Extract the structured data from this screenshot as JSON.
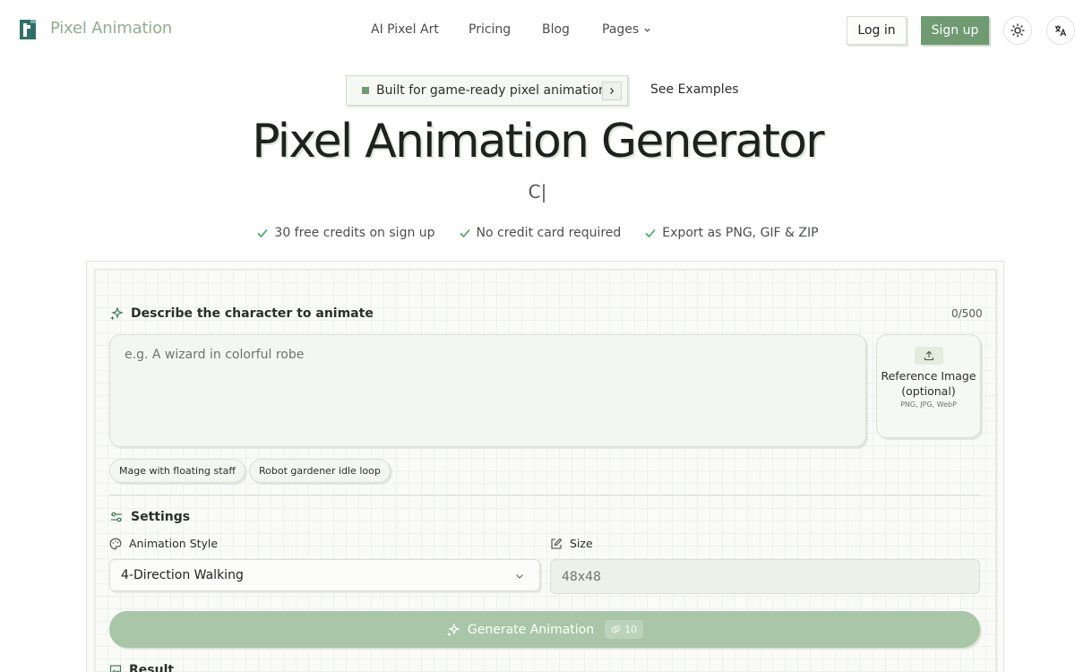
{
  "header": {
    "brand": "Pixel Animation",
    "nav": [
      {
        "label": "AI Pixel Art"
      },
      {
        "label": "Pricing"
      },
      {
        "label": "Blog"
      },
      {
        "label": "Pages"
      }
    ],
    "login_label": "Log in",
    "signup_label": "Sign up"
  },
  "hero": {
    "announcement": "Built for game-ready pixel animation",
    "see_examples": "See Examples",
    "title": "Pixel Animation Generator",
    "typing_text": "C|",
    "features": [
      {
        "label": "30 free credits on sign up"
      },
      {
        "label": "No credit card required"
      },
      {
        "label": "Export as PNG, GIF & ZIP"
      }
    ]
  },
  "generator": {
    "describe_title": "Describe the character to animate",
    "char_count": "0/500",
    "prompt_placeholder": "e.g. A wizard in colorful robe",
    "prompt_value": "",
    "reference_label": "Reference Image (optional)",
    "reference_formats": "PNG, JPG, WebP",
    "suggestions": [
      {
        "label": "Mage with floating staff"
      },
      {
        "label": "Robot gardener idle loop"
      }
    ],
    "settings_title": "Settings",
    "animation_style_label": "Animation Style",
    "animation_style_value": "4-Direction Walking",
    "size_label": "Size",
    "size_value": "48x48",
    "generate_label": "Generate Animation",
    "generate_cost": "10",
    "result_title": "Result"
  },
  "colors": {
    "brand_green": "#6f9a72",
    "brand_text": "#8fae8f",
    "button_disabled": "#a9c6a8",
    "check_green": "#3aa655"
  },
  "icons": {
    "logo": "logo-mark-icon",
    "theme": "sun-icon",
    "language": "translate-icon",
    "sparkle": "sparkles-icon",
    "upload": "upload-icon",
    "settings": "sliders-icon",
    "palette": "palette-icon",
    "size": "edit-icon",
    "credits": "coin-icon",
    "result": "image-icon"
  }
}
